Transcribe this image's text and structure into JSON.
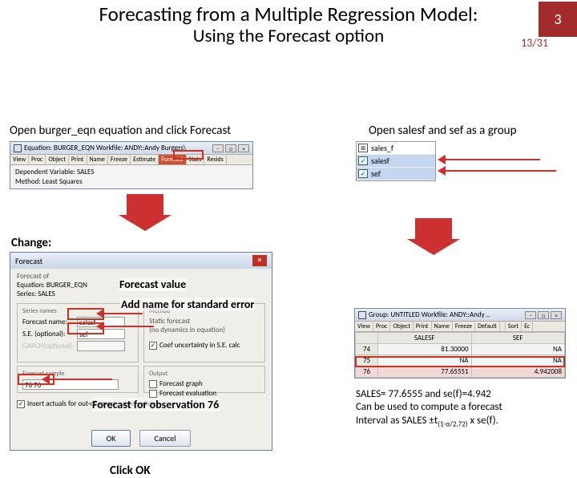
{
  "header": {
    "title_main": "Forecasting from a Multiple Regression Model:",
    "title_sub": "Using the Forecast option",
    "page_num": "3"
  },
  "captions": {
    "left_top": "Open burger_eqn equation and click Forecast",
    "right_top": "Open salesf and sef  as a group",
    "change": "Change:",
    "anno_forecast_value": "Forecast value",
    "anno_add_se": "Add name for standard error",
    "anno_obs76": "Forecast for observation 76",
    "anno_click_ok": "Click OK"
  },
  "eq_window": {
    "title": "Equation: BURGER_EQN   Workfile: ANDY::Andy Burgers\\",
    "toolbar": [
      "View",
      "Proc",
      "Object",
      "Print",
      "Name",
      "Freeze",
      "Estimate",
      "Forecast",
      "Stats",
      "Resids"
    ],
    "dep": "Dependent Variable: SALES",
    "method": "Method: Least Squares"
  },
  "series": {
    "items": [
      {
        "icon": "⊞",
        "label": "sales_f"
      },
      {
        "icon": "✓",
        "label": "salesf"
      },
      {
        "icon": "✓",
        "label": "sef"
      }
    ]
  },
  "forecast": {
    "title": "Forecast",
    "fc_of": "Forecast of",
    "eq_label": "Equation: BURGER_EQN",
    "series_label": "Series: SALES",
    "series_names": "Series names",
    "fc_name_lbl": "Forecast name:",
    "fc_name_val": "salesf",
    "se_lbl": "S.E. (optional):",
    "se_val": "sef",
    "garch_lbl": "GARCH(optional):",
    "method_title": "Method",
    "method_text": "Static forecast\n(no dynamics in equation)",
    "coef_unc": "Coef uncertainty in S.E. calc",
    "fc_sample": "Forecast sample",
    "fc_sample_val": "76 76",
    "output": "Output",
    "out_graph": "Forecast graph",
    "out_eval": "Forecast evaluation",
    "insert_actuals": "Insert actuals for out-of-sample observations",
    "ok": "OK",
    "cancel": "Cancel"
  },
  "group_window": {
    "title": "Group: UNTITLED   Workfile: ANDY::Andy ..",
    "toolbar": [
      "View",
      "Proc",
      "Object",
      "Print",
      "Name",
      "Freeze",
      "Default",
      "",
      "Sort",
      "Ec"
    ],
    "cols": [
      "",
      "SALESF",
      "SEF"
    ],
    "rows": [
      {
        "n": "74",
        "salesf": "81.30000",
        "sef": "NA"
      },
      {
        "n": "75",
        "salesf": "NA",
        "sef": "NA"
      },
      {
        "n": "76",
        "salesf": "77.65551",
        "sef": "4.942008"
      }
    ]
  },
  "result": {
    "line1": "SALES= 77.6555 and se(f)=4.942",
    "line2": "Can be used to compute a forecast",
    "line3_a": "Interval as SALES ±t",
    "line3_sub": "(1-α/2,72)",
    "line3_b": " x se(f)."
  },
  "footer": {
    "count": "13/31"
  }
}
